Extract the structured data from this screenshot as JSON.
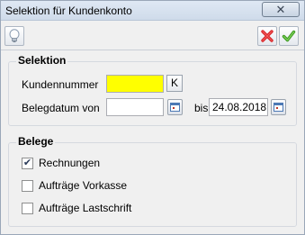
{
  "window": {
    "title": "Selektion für Kundenkonto",
    "close_glyph": "✕"
  },
  "toolbar": {
    "hint_icon": "lightbulb-icon",
    "cancel_icon": "red-x-icon",
    "ok_icon": "green-check-icon"
  },
  "selektion": {
    "title": "Selektion",
    "kundennummer_label": "Kundennummer",
    "kundennummer_value": "",
    "kundennummer_color": "#ffff00",
    "k_button_label": "K",
    "belegdatum_label": "Belegdatum von",
    "belegdatum_von_value": "",
    "bis_label": "bis",
    "belegdatum_bis_value": "24.08.2018"
  },
  "belege": {
    "title": "Belege",
    "items": [
      {
        "label": "Rechnungen",
        "checked": true
      },
      {
        "label": "Aufträge Vorkasse",
        "checked": false
      },
      {
        "label": "Aufträge Lastschrift",
        "checked": false
      }
    ]
  }
}
